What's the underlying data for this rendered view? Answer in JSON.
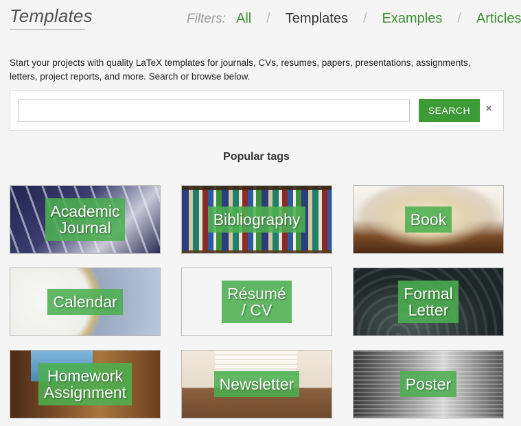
{
  "header": {
    "title": "Templates",
    "filters_label": "Filters:",
    "filters": [
      {
        "label": "All",
        "active": false
      },
      {
        "label": "Templates",
        "active": true
      },
      {
        "label": "Examples",
        "active": false
      },
      {
        "label": "Articles",
        "active": false
      }
    ],
    "separator": "/"
  },
  "intro": "Start your projects with quality LaTeX templates for journals, CVs, resumes, papers, presentations, assignments, letters, project reports, and more. Search or browse below.",
  "search": {
    "value": "",
    "placeholder": "",
    "button_label": "SEARCH",
    "clear_icon": "×"
  },
  "popular_tags": {
    "heading": "Popular tags",
    "tags": [
      {
        "label": "Academic\nJournal"
      },
      {
        "label": "Bibliography"
      },
      {
        "label": "Book"
      },
      {
        "label": "Calendar"
      },
      {
        "label": "Résumé\n/ CV"
      },
      {
        "label": "Formal\nLetter"
      },
      {
        "label": "Homework\nAssignment"
      },
      {
        "label": "Newsletter"
      },
      {
        "label": "Poster"
      }
    ]
  },
  "colors": {
    "accent": "#3d9a36",
    "tag_background": "#4caf50",
    "link": "#3c8f32"
  }
}
